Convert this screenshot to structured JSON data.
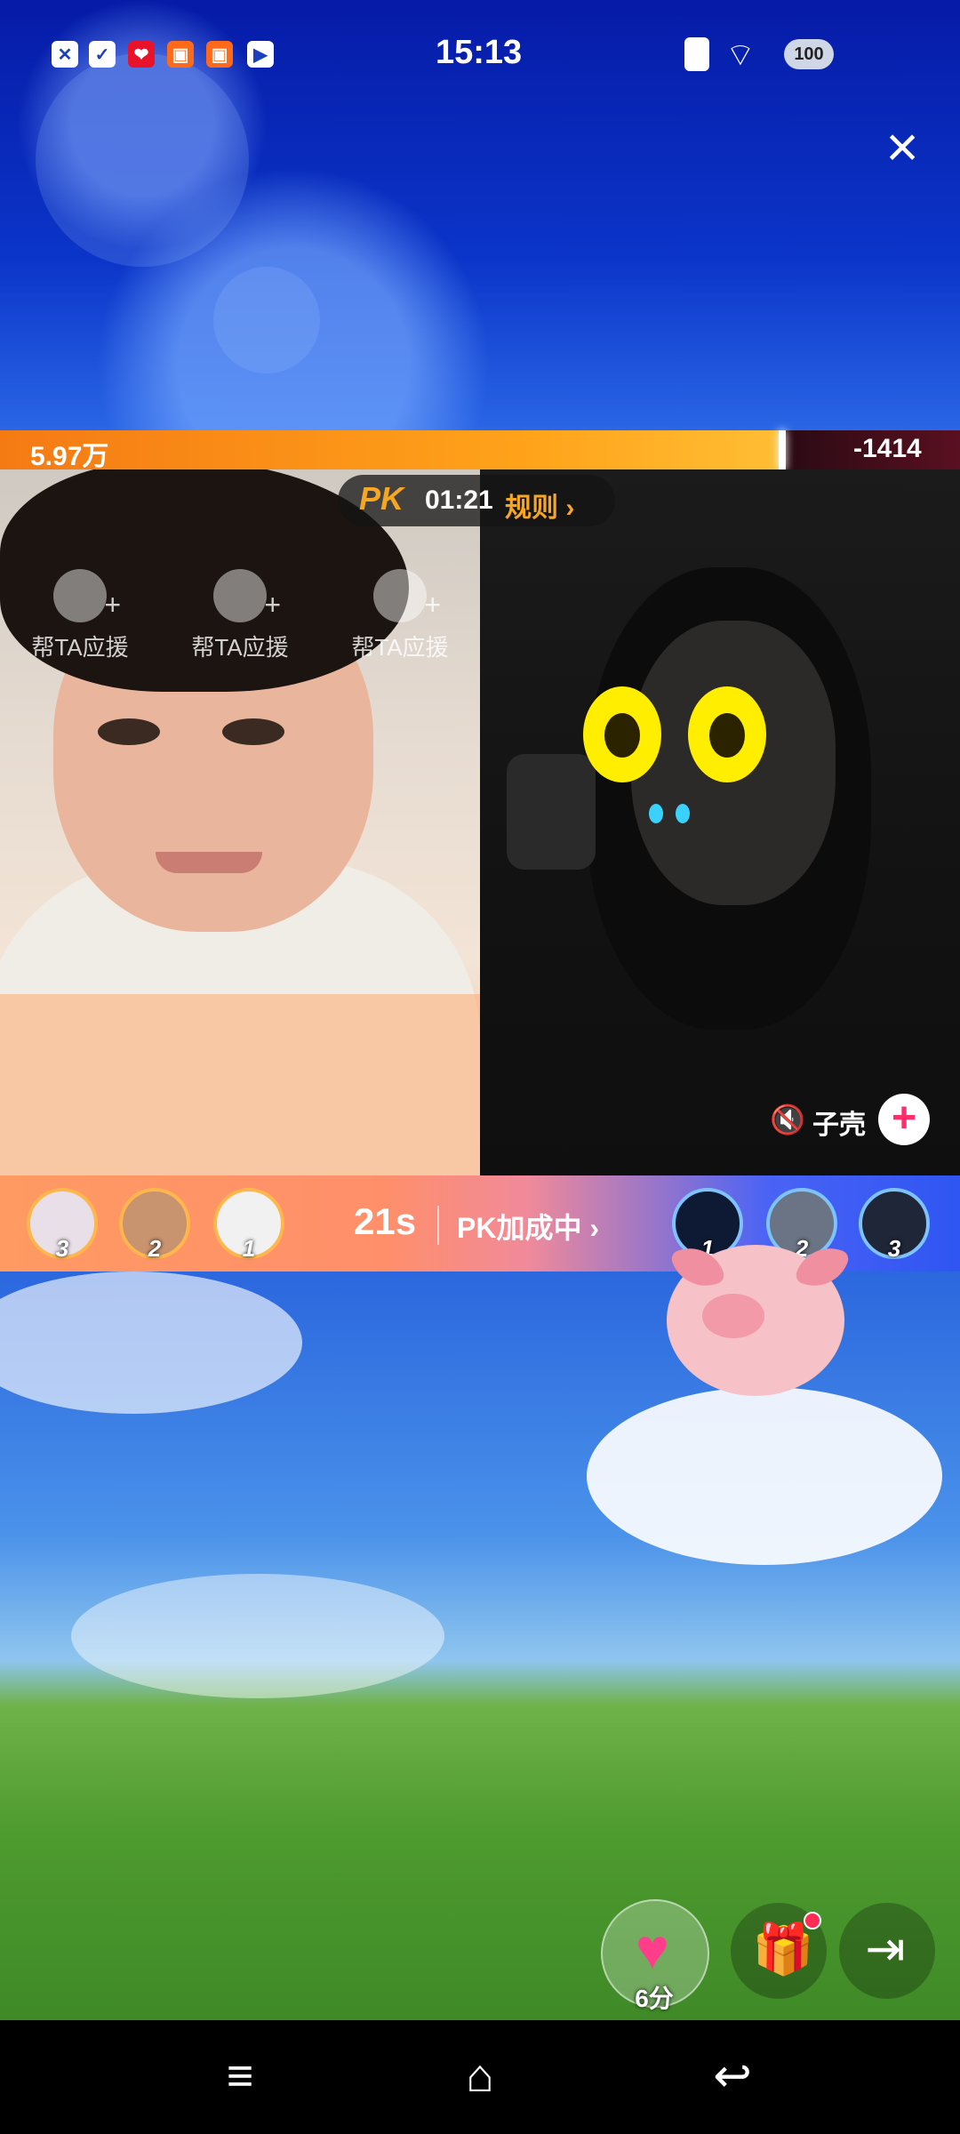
{
  "status_bar": {
    "time": "15:13",
    "battery": "100",
    "icons": [
      "close-square-icon",
      "check-square-icon",
      "app-red-icon",
      "app-orange-icon",
      "app-orange-icon",
      "play-icon"
    ],
    "right_icons": [
      "vibrate-icon",
      "wifi-icon",
      "battery-icon"
    ]
  },
  "top": {
    "close_label": "×"
  },
  "pk": {
    "left_score": "5.97万",
    "right_score": "-1414",
    "logo": "PK",
    "timer": "01:21",
    "rules_label": "规则 ›"
  },
  "left_stream": {
    "support_items": [
      "帮TA应援",
      "帮TA应援",
      "帮TA应援"
    ]
  },
  "right_stream": {
    "name": "子壳",
    "mute_icon": "mute-icon",
    "follow_label": "+"
  },
  "contribution": {
    "countdown": "21s",
    "bonus_label": "PK加成中 ›",
    "left_ranks": [
      "3",
      "2",
      "1"
    ],
    "right_ranks": [
      "1",
      "2",
      "3"
    ]
  },
  "actions": {
    "heart_score": "6分",
    "heart_icon": "♥",
    "gift_icon": "🎁",
    "share_icon": "⇥"
  },
  "nav": {
    "menu_icon": "≡",
    "home_icon": "⌂",
    "back_icon": "↩"
  },
  "colors": {
    "accent_orange": "#f5a623",
    "follow_pink": "#ff2d6a"
  }
}
